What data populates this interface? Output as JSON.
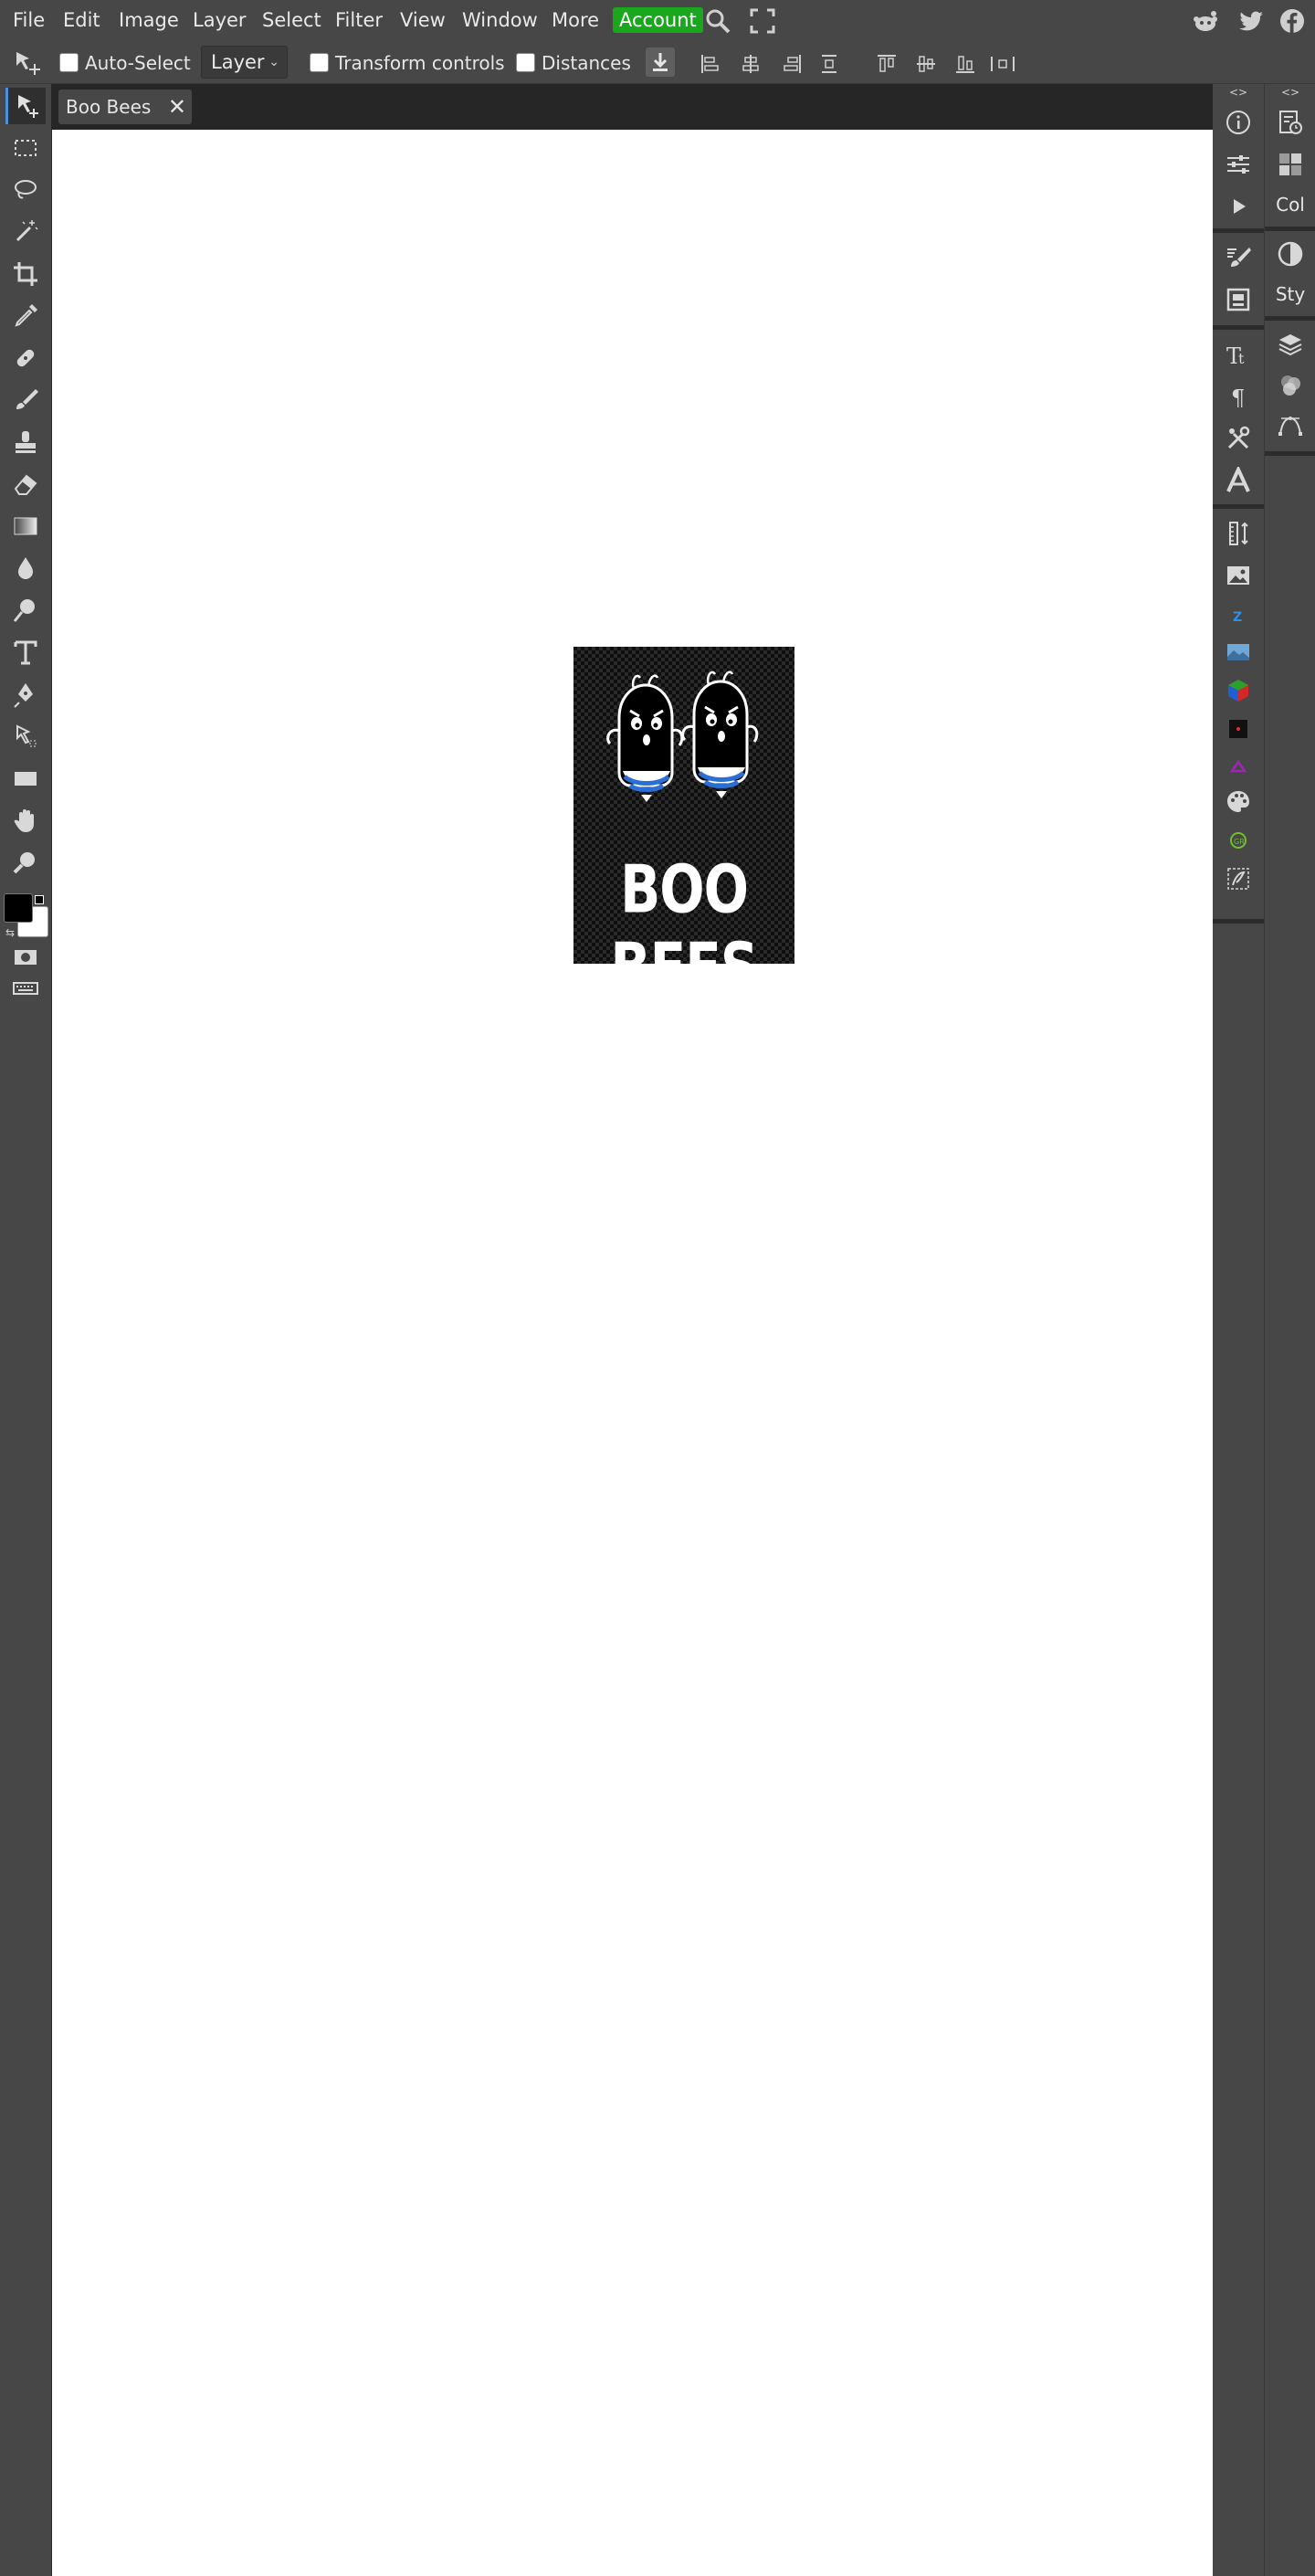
{
  "menu": {
    "file": "File",
    "edit": "Edit",
    "image": "Image",
    "layer": "Layer",
    "select": "Select",
    "filter": "Filter",
    "view": "View",
    "window": "Window",
    "more": "More",
    "account": "Account"
  },
  "options": {
    "auto_select": "Auto-Select",
    "layer_select": "Layer",
    "transform_controls": "Transform controls",
    "distances": "Distances"
  },
  "document": {
    "tab_title": "Boo Bees",
    "close_glyph": "✕",
    "artwork_text": "BOO BEES"
  },
  "right_panels": {
    "collapse_glyph": "<>",
    "col_label": "Col",
    "sty_label": "Sty"
  },
  "colors": {
    "accent": "#1aa71d",
    "active_tool": "#4c8fe0",
    "foreground": "#000000",
    "background": "#ffffff"
  }
}
